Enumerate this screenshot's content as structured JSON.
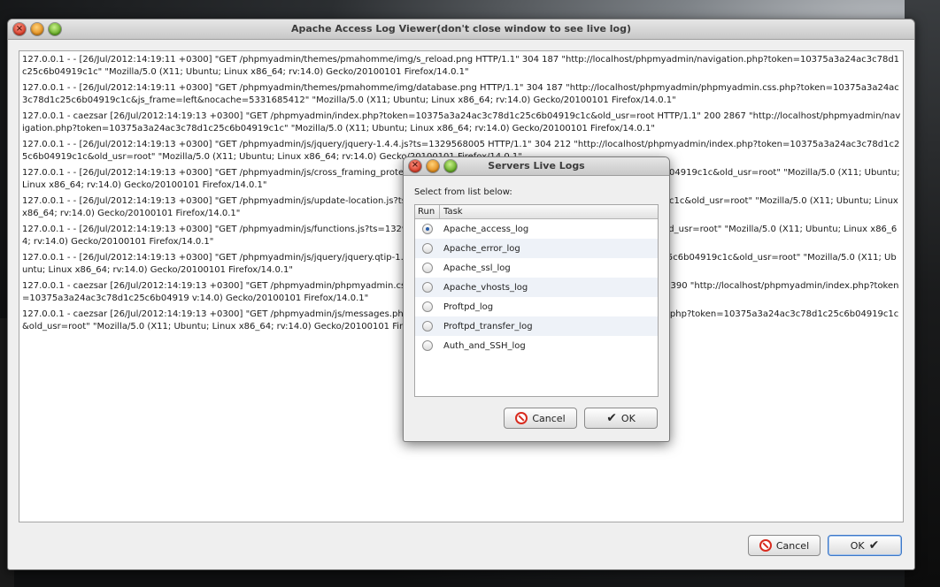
{
  "main_window": {
    "title": "Apache Access Log Viewer(don't close window to see live log)",
    "log_lines": [
      "127.0.0.1 - - [26/Jul/2012:14:19:11 +0300] \"GET /phpmyadmin/themes/pmahomme/img/s_reload.png HTTP/1.1\" 304 187 \"http://localhost/phpmyadmin/navigation.php?token=10375a3a24ac3c78d1c25c6b04919c1c\" \"Mozilla/5.0 (X11; Ubuntu; Linux x86_64; rv:14.0) Gecko/20100101 Firefox/14.0.1\"",
      "127.0.0.1 - - [26/Jul/2012:14:19:11 +0300] \"GET /phpmyadmin/themes/pmahomme/img/database.png HTTP/1.1\" 304 187 \"http://localhost/phpmyadmin/phpmyadmin.css.php?token=10375a3a24ac3c78d1c25c6b04919c1c&js_frame=left&nocache=5331685412\" \"Mozilla/5.0 (X11; Ubuntu; Linux x86_64; rv:14.0) Gecko/20100101 Firefox/14.0.1\"",
      "127.0.0.1 - caezsar [26/Jul/2012:14:19:13 +0300] \"GET /phpmyadmin/index.php?token=10375a3a24ac3c78d1c25c6b04919c1c&old_usr=root HTTP/1.1\" 200 2867 \"http://localhost/phpmyadmin/navigation.php?token=10375a3a24ac3c78d1c25c6b04919c1c\" \"Mozilla/5.0 (X11; Ubuntu; Linux x86_64; rv:14.0) Gecko/20100101 Firefox/14.0.1\"",
      "127.0.0.1 - - [26/Jul/2012:14:19:13 +0300] \"GET /phpmyadmin/js/jquery/jquery-1.4.4.js?ts=1329568005 HTTP/1.1\" 304 212 \"http://localhost/phpmyadmin/index.php?token=10375a3a24ac3c78d1c25c6b04919c1c&old_usr=root\" \"Mozilla/5.0 (X11; Ubuntu; Linux x86_64; rv:14.0) Gecko/20100101 Firefox/14.0.1\"",
      "127.0.0.1 - - [26/Jul/2012:14:19:13 +0300] \"GET /phpmyadmin/js/cross_framing_protectio",
      "127.0.0.1 - - [26/Jul/2012:14:19:13 +0300] \"GET /phpmyadmin/js/update-location.js?ts=13",
      "127.0.0.1 - - [26/Jul/2012:14:19:13 +0300] \"GET /phpmyadmin/js/functions.js?ts=1329568",
      "127.0.0.1 - - [26/Jul/2012:14:19:13 +0300] \"GET /phpmyadmin/js/jquery/jquery.qtip-1.0.0.",
      "127.0.0.1 - caezsar [26/Jul/2012:14:19:13 +0300] \"GET /phpmyadmin/phpmyadmin.css.php",
      "127.0.0.1 - caezsar [26/Jul/2012:14:19:13 +0300] \"GET /phpmyadmin/js/messages.php?la"
    ],
    "log_tails": [
      "",
      "",
      "",
      "",
      "admin/index.php? token=10375a3a24ac3c78d1c25c6b04919c1c&old_usr=root\" \"Mozilla/5.0 (X11; Ubuntu; Linux x86_64; rv:14.0) Gecko/20100101 Firefox/14.0.1\"",
      "ndex.php? token=10375a3a24ac3c78d1c25c6b04919c1c&old_usr=root\" \"Mozilla/5.0 (X11; Ubuntu; Linux x86_64; rv:14.0) Gecko/20100101 Firefox/14.0.1\"",
      "hp? token=10375a3a24ac3c78d1c25c6b04919c1c&old_usr=root\" \"Mozilla/5.0 (X11; Ubuntu; Linux x86_64; rv:14.0) Gecko/20100101 Firefox/14.0.1\"",
      "pmyadmin/index.php? token=10375a3a24ac3c78d1c25c6b04919c1c&old_usr=root\" \"Mozilla/5.0 (X11; Ubuntu; Linux x86_64; rv:14.0) Gecko/20100101 Firefox/14.0.1\"",
      "frame=right&nocache=3988383895 HTTP/1.1\" 200 9390 \"http://localhost/phpmyadmin/index.php?token=10375a3a24ac3c78d1c25c6b04919 v:14.0) Gecko/20100101 Firefox/14.0.1\"",
      "TP/1.1\" 200 5332 \"http://localhost/phpmyadmin/ index.php?token=10375a3a24ac3c78d1c25c6b04919c1c&old_usr=root\" \"Mozilla/5.0 (X11; Ubuntu; Linux x86_64; rv:14.0) Gecko/20100101 Firefox/14.0.1\""
    ],
    "cancel_label": "Cancel",
    "ok_label": "OK"
  },
  "dialog": {
    "title": "Servers Live Logs",
    "prompt": "Select from list below:",
    "col_run": "Run",
    "col_task": "Task",
    "tasks": [
      {
        "name": "Apache_access_log",
        "checked": true
      },
      {
        "name": "Apache_error_log",
        "checked": false
      },
      {
        "name": "Apache_ssl_log",
        "checked": false
      },
      {
        "name": "Apache_vhosts_log",
        "checked": false
      },
      {
        "name": "Proftpd_log",
        "checked": false
      },
      {
        "name": "Proftpd_transfer_log",
        "checked": false
      },
      {
        "name": "Auth_and_SSH_log",
        "checked": false
      }
    ],
    "cancel_label": "Cancel",
    "ok_label": "OK"
  }
}
